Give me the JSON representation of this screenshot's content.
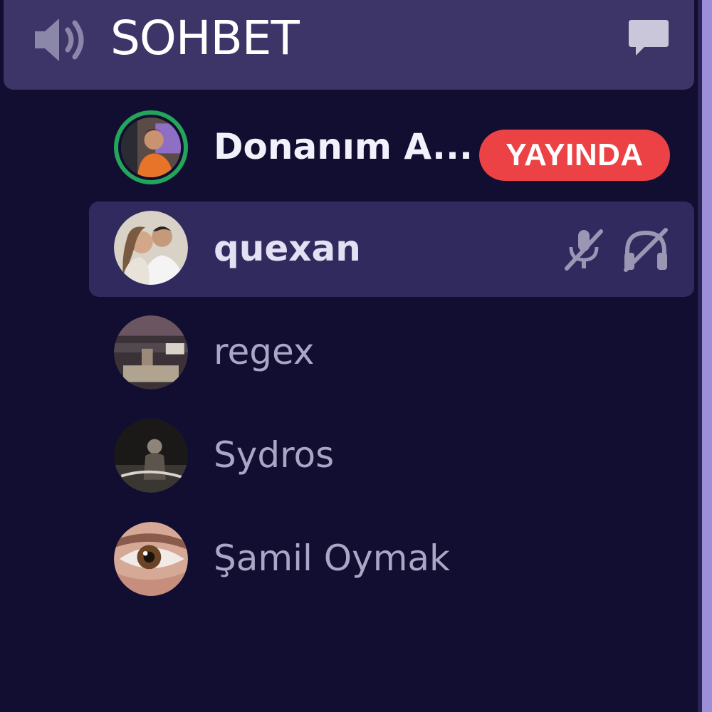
{
  "channel": {
    "name": "SOHBET",
    "speaker_icon": "speaker-icon",
    "chat_icon": "chat-bubble-icon"
  },
  "users": [
    {
      "name": "Donanım A...",
      "badge": "YAYINDA",
      "live": true,
      "status_color": "#23a55a",
      "badge_color": "#ed4245"
    },
    {
      "name": "quexan",
      "muted": true,
      "deafened": true,
      "icons": [
        "microphone-muted-icon",
        "headphones-deafened-icon"
      ]
    },
    {
      "name": "regex"
    },
    {
      "name": "Sydros"
    },
    {
      "name": "Şamil Oymak"
    }
  ],
  "colors": {
    "background": "#120e31",
    "header": "#3d3567",
    "active_row": "#312a5e",
    "accent_edge": "#9b8fd8"
  }
}
